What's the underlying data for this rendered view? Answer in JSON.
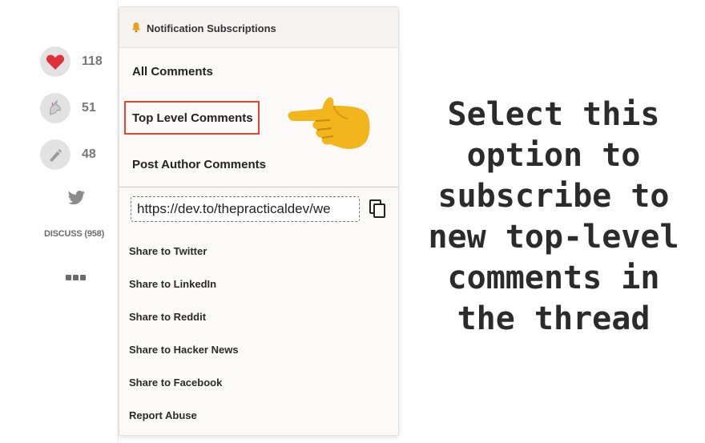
{
  "sidebar": {
    "reactions": [
      {
        "icon": "heart-icon",
        "count": "118"
      },
      {
        "icon": "unicorn-icon",
        "count": "51"
      },
      {
        "icon": "bookmark-icon",
        "count": "48"
      }
    ],
    "discuss_label": "DISCUSS (958)"
  },
  "menu": {
    "title": "Notification Subscriptions",
    "options": {
      "all": "All Comments",
      "top_level": "Top Level Comments",
      "post_author": "Post Author Comments"
    },
    "url_value": "https://dev.to/thepracticaldev/we",
    "share_items": {
      "twitter": "Share to Twitter",
      "linkedin": "Share to LinkedIn",
      "reddit": "Share to Reddit",
      "hacker_news": "Share to Hacker News",
      "facebook": "Share to Facebook",
      "report": "Report Abuse"
    }
  },
  "annotation": {
    "lines": [
      "Select this",
      "option to",
      "subscribe to",
      "new top-level",
      "comments in",
      "the thread"
    ]
  },
  "colors": {
    "highlight": "#e8442f",
    "heart": "#e0303a",
    "hand": "#f2b51c"
  }
}
